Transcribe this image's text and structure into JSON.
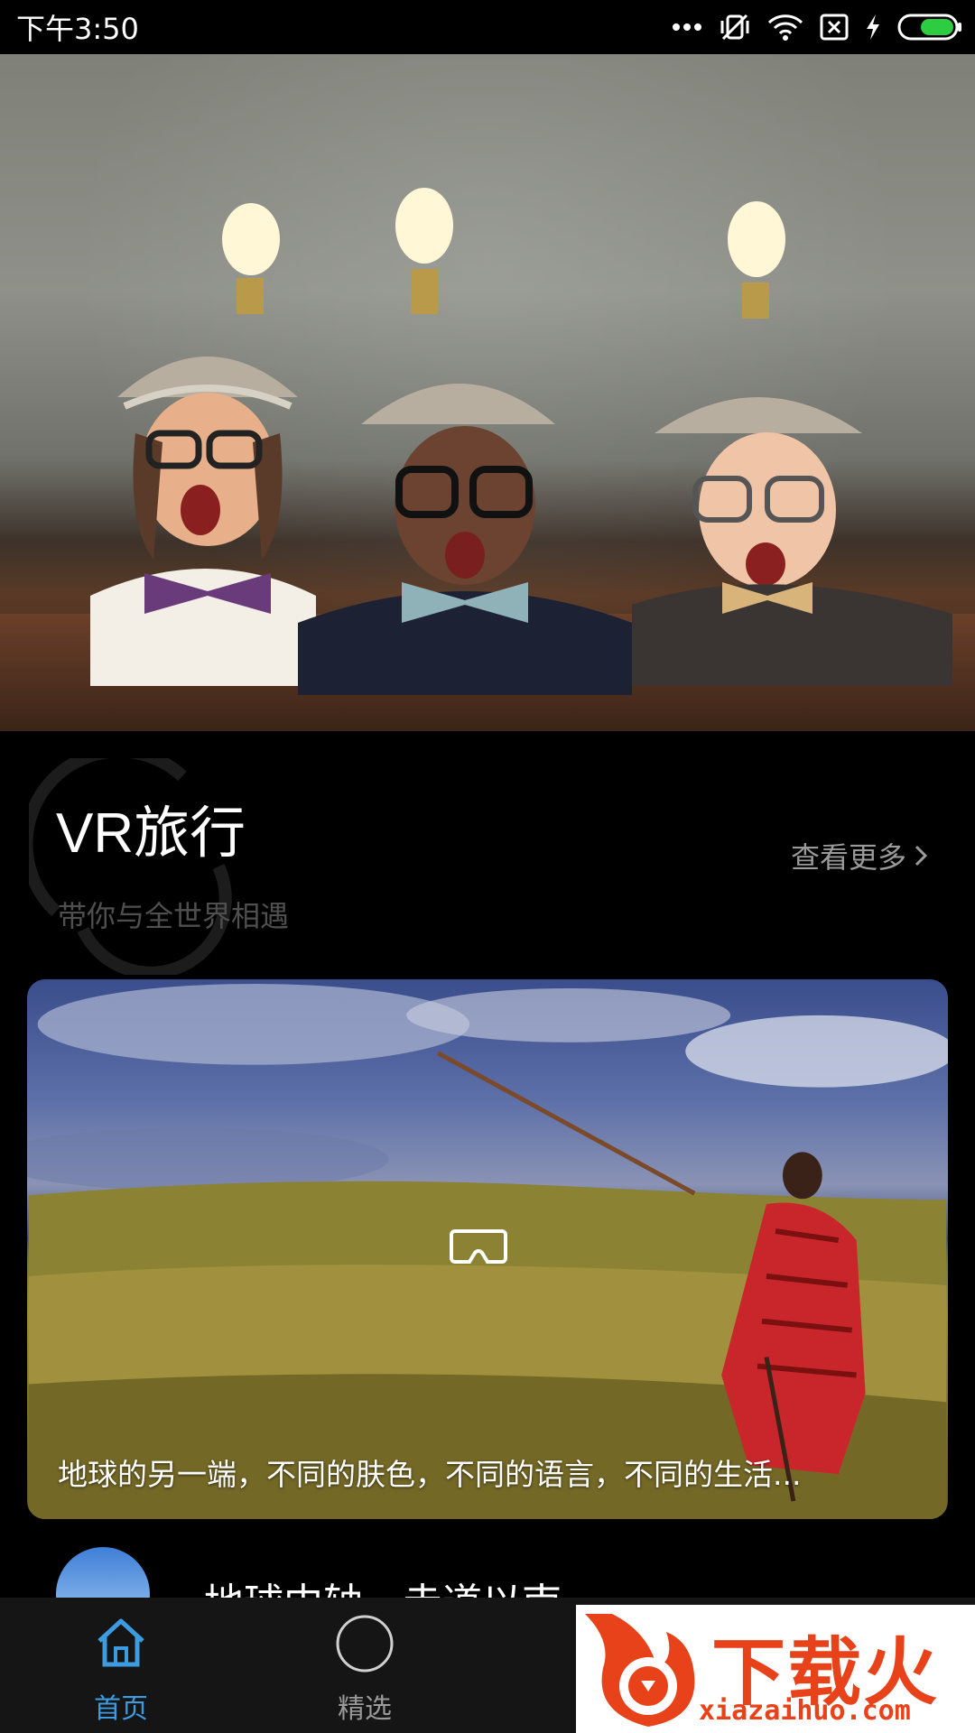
{
  "status_bar": {
    "time": "下午3:50",
    "icons": [
      "more-dots-icon",
      "vibrate-off-icon",
      "wifi-icon",
      "sim-off-icon",
      "charging-icon",
      "battery-icon"
    ],
    "battery_color": "#2ecc40"
  },
  "banner": {
    "image": "three children wearing lightbulb thinking caps",
    "slide_count": 5,
    "active_slide": 1
  },
  "section": {
    "title": "VR旅行",
    "subtitle": "带你与全世界相遇",
    "more_label": "查看更多"
  },
  "card": {
    "caption": "地球的另一端，不同的肤色，不同的语言，不同的生活...",
    "icon": "vr-headset-icon"
  },
  "next_item": {
    "title": "地球中轴，赤道以南"
  },
  "tab_bar": {
    "tabs": [
      {
        "label": "首页",
        "icon": "home-icon",
        "active": true
      },
      {
        "label": "精选",
        "icon": "circle-icon",
        "active": false
      }
    ],
    "active_color": "#3d9be0",
    "inactive_color": "#9a9a9a"
  },
  "watermark": {
    "text": "下载火",
    "url": "xiazaihuo.com"
  }
}
